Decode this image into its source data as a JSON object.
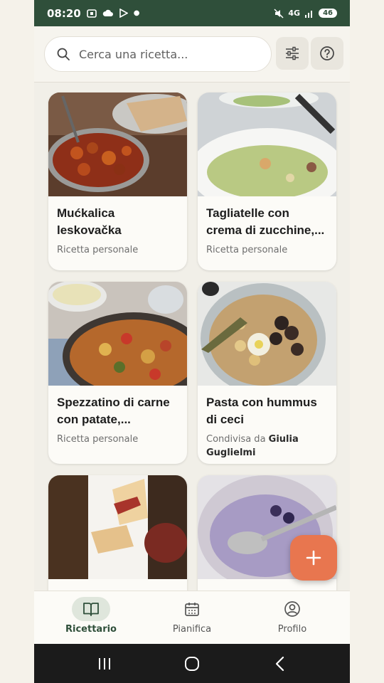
{
  "status": {
    "time": "08:20",
    "network": "4G",
    "battery": "46"
  },
  "search": {
    "placeholder": "Cerca una ricetta..."
  },
  "icons": {
    "search": "search-icon",
    "filter": "sliders-icon",
    "help": "help-circle-icon",
    "add": "plus-icon"
  },
  "colors": {
    "accent": "#2f4f3a",
    "fab": "#e8764f",
    "background": "#f1efe8"
  },
  "recipes": [
    {
      "title": "Mućkalica leskovačka",
      "subtitle": "Ricetta personale"
    },
    {
      "title": "Tagliatelle con crema di zucchine,...",
      "subtitle": "Ricetta personale"
    },
    {
      "title": "Spezzatino di carne con patate,...",
      "subtitle": "Ricetta personale"
    },
    {
      "title": "Pasta con hummus di ceci",
      "subtitle_prefix": "Condivisa da",
      "subtitle_author": "Giulia Guglielmi"
    },
    {
      "title": "",
      "subtitle": ""
    },
    {
      "title": "",
      "subtitle": ""
    }
  ],
  "nav": [
    {
      "label": "Ricettario",
      "active": true
    },
    {
      "label": "Pianifica",
      "active": false
    },
    {
      "label": "Profilo",
      "active": false
    }
  ]
}
